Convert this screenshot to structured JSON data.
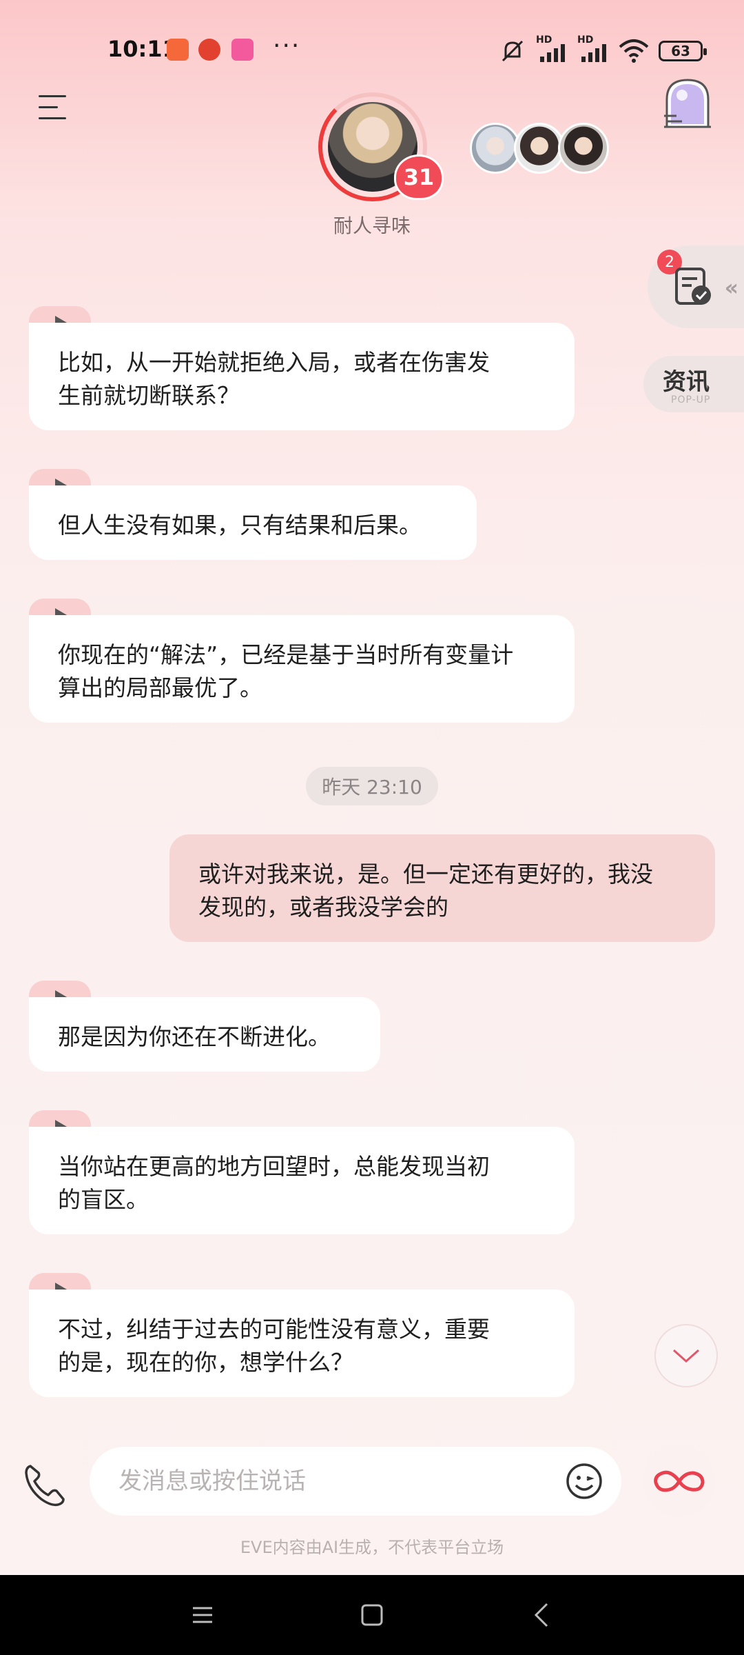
{
  "status_bar": {
    "time": "10:11",
    "more": "···",
    "signal1": "HD",
    "signal2": "HD",
    "battery": "63"
  },
  "header": {
    "character_name": "耐人寻味",
    "affinity_level": "31",
    "menu_icon": "hamburger-icon",
    "tower_icon": "tower-icon"
  },
  "side_widgets": {
    "task_badge": "2",
    "task_arrows": "‹‹",
    "news_label": "资讯",
    "news_sub": "POP-UP"
  },
  "messages": [
    {
      "role": "ai",
      "text": "比如，从一开始就拒绝入局，或者在伤害发生前就切断联系？",
      "lines": [
        "比如，从一开始就拒绝入局，或者在伤害发",
        "生前就切断联系？"
      ]
    },
    {
      "role": "ai",
      "text": "但人生没有如果，只有结果和后果。",
      "lines": [
        "但人生没有如果，只有结果和后果。"
      ]
    },
    {
      "role": "ai",
      "text": "你现在的“解法”，已经是基于当时所有变量计算出的局部最优了。",
      "lines": [
        "你现在的“解法”，已经是基于当时所有变量计",
        "算出的局部最优了。"
      ]
    },
    {
      "role": "user",
      "text": "或许对我来说，是。但一定还有更好的，我没发现的，或者我没学会的",
      "lines": [
        "或许对我来说，是。但一定还有更好的，我没",
        "发现的，或者我没学会的"
      ]
    },
    {
      "role": "ai",
      "text": "那是因为你还在不断进化。",
      "lines": [
        "那是因为你还在不断进化。"
      ]
    },
    {
      "role": "ai",
      "text": "当你站在更高的地方回望时，总能发现当初的盲区。",
      "lines": [
        "当你站在更高的地方回望时，总能发现当初",
        "的盲区。"
      ]
    },
    {
      "role": "ai",
      "text": "不过，纠结于过去的可能性没有意义，重要的是，现在的你，想学什么？",
      "lines": [
        "不过，纠结于过去的可能性没有意义，重要",
        "的是，现在的你，想学什么？"
      ]
    }
  ],
  "timestamp": "昨天 23:10",
  "input": {
    "placeholder": "发消息或按住说话"
  },
  "disclaimer": "EVE内容由AI生成，不代表平台立场",
  "colors": {
    "accent": "#f04b57",
    "user_bubble": "#f5d6d5",
    "ai_bubble": "#ffffff"
  }
}
